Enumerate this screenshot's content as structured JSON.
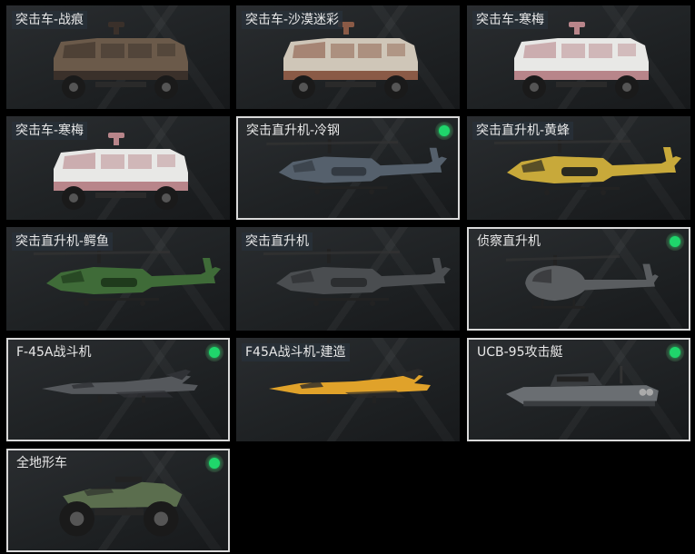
{
  "vehicles": [
    {
      "name": "突击车-战痕",
      "owned": false,
      "selected": false,
      "icon": "armored-truck-icon",
      "colors": {
        "body": "#6b5a4a",
        "accent": "#3a302a"
      }
    },
    {
      "name": "突击车-沙漠迷彩",
      "owned": false,
      "selected": false,
      "icon": "armored-truck-icon",
      "colors": {
        "body": "#cfc6b8",
        "accent": "#8a5a46"
      }
    },
    {
      "name": "突击车-寒梅",
      "owned": false,
      "selected": false,
      "icon": "armored-truck-icon",
      "colors": {
        "body": "#e8e8e6",
        "accent": "#b8858a"
      }
    },
    {
      "name": "突击车-寒梅",
      "owned": false,
      "selected": false,
      "icon": "armored-truck-icon",
      "colors": {
        "body": "#e8e8e6",
        "accent": "#b8858a"
      }
    },
    {
      "name": "突击直升机-冷钢",
      "owned": true,
      "selected": true,
      "icon": "attack-helicopter-icon",
      "colors": {
        "body": "#55606c",
        "accent": "#333a42"
      }
    },
    {
      "name": "突击直升机-黄蜂",
      "owned": false,
      "selected": false,
      "icon": "attack-helicopter-icon",
      "colors": {
        "body": "#c8a93a",
        "accent": "#2a2a20"
      }
    },
    {
      "name": "突击直升机-鳄鱼",
      "owned": false,
      "selected": false,
      "icon": "attack-helicopter-icon",
      "colors": {
        "body": "#3f6b38",
        "accent": "#1f3a1c"
      }
    },
    {
      "name": "突击直升机",
      "owned": false,
      "selected": false,
      "icon": "attack-helicopter-icon",
      "colors": {
        "body": "#4a4d50",
        "accent": "#2c2e30"
      }
    },
    {
      "name": "侦察直升机",
      "owned": true,
      "selected": true,
      "icon": "scout-helicopter-icon",
      "colors": {
        "body": "#5a5d60",
        "accent": "#2f3133"
      }
    },
    {
      "name": "F-45A战斗机",
      "owned": true,
      "selected": true,
      "icon": "fighter-jet-icon",
      "colors": {
        "body": "#55585c",
        "accent": "#303236"
      }
    },
    {
      "name": "F45A战斗机-建造",
      "owned": false,
      "selected": false,
      "icon": "fighter-jet-icon",
      "colors": {
        "body": "#e0a22a",
        "accent": "#2a2a2a"
      }
    },
    {
      "name": "UCB-95攻击艇",
      "owned": true,
      "selected": true,
      "icon": "attack-boat-icon",
      "colors": {
        "body": "#6a6e72",
        "accent": "#3a3d40"
      }
    },
    {
      "name": "全地形车",
      "owned": true,
      "selected": true,
      "icon": "atv-icon",
      "colors": {
        "body": "#5b6e4e",
        "accent": "#262626"
      }
    }
  ]
}
